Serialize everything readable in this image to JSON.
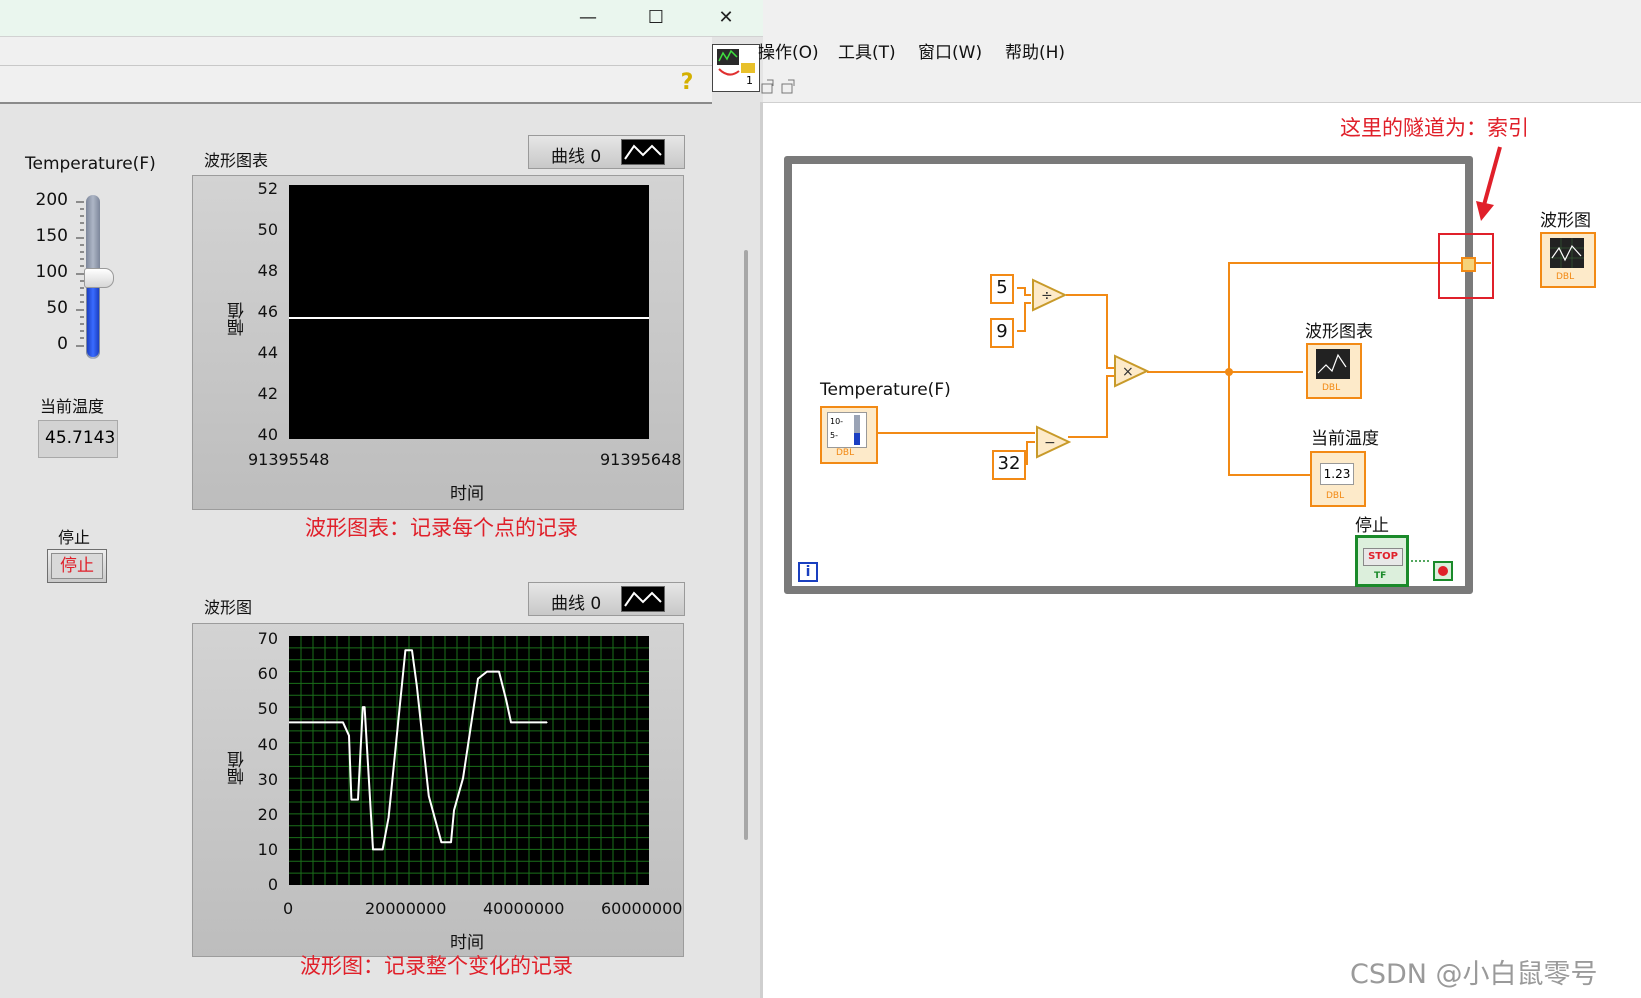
{
  "front_panel": {
    "window_buttons": {
      "minimize": "—",
      "maximize": "☐",
      "close": "✕"
    },
    "help_icon": "?",
    "vi_icon_badge": "1",
    "slider": {
      "label": "Temperature(F)",
      "ticks": [
        "200",
        "150",
        "100",
        "50",
        "0"
      ],
      "value": 100,
      "range": [
        0,
        200
      ]
    },
    "current_temp": {
      "label": "当前温度",
      "value": "45.7143"
    },
    "stop": {
      "label": "停止",
      "button_text": "停止"
    },
    "waveform_chart": {
      "title": "波形图表",
      "legend": "曲线 0",
      "ylabel": "幅值",
      "xlabel": "时间",
      "y_ticks": [
        "52",
        "50",
        "48",
        "46",
        "44",
        "42",
        "40"
      ],
      "x_ticks": [
        "91395548",
        "91395648"
      ],
      "annotation": "波形图表：记录每个点的记录"
    },
    "waveform_graph": {
      "title": "波形图",
      "legend": "曲线 0",
      "ylabel": "幅值",
      "xlabel": "时间",
      "y_ticks": [
        "70",
        "60",
        "50",
        "40",
        "30",
        "20",
        "10",
        "0"
      ],
      "x_ticks": [
        "0",
        "20000000",
        "40000000",
        "60000000"
      ],
      "annotation": "波形图：记录整个变化的记录"
    }
  },
  "chart_data": [
    {
      "type": "line",
      "title": "波形图表",
      "xlabel": "时间",
      "ylabel": "幅值",
      "series": [
        {
          "name": "曲线 0",
          "x": [
            91395548,
            91395648
          ],
          "y": [
            45.7143,
            45.7143
          ]
        }
      ],
      "xlim": [
        91395548,
        91395648
      ],
      "ylim": [
        40,
        52
      ],
      "grid": false
    },
    {
      "type": "line",
      "title": "波形图",
      "xlabel": "时间",
      "ylabel": "幅值",
      "series": [
        {
          "name": "曲线 0",
          "x": [
            0,
            9000000,
            10000000,
            10400000,
            11500000,
            12300000,
            12600000,
            14000000,
            15600000,
            16600000,
            19400000,
            20500000,
            21300000,
            23300000,
            25400000,
            27000000,
            27500000,
            29000000,
            31500000,
            33000000,
            35000000,
            36200000,
            37000000,
            43000000
          ],
          "y": [
            45.7,
            45.7,
            42,
            24,
            24,
            50,
            50,
            10,
            10,
            19,
            66,
            66,
            56,
            25,
            12,
            12,
            21,
            30,
            58,
            60,
            60,
            52,
            45.7,
            45.7
          ]
        }
      ],
      "xlim": [
        0,
        60000000
      ],
      "ylim": [
        0,
        70
      ],
      "grid": true
    }
  ],
  "block_diagram": {
    "menus": [
      "操作(O)",
      "工具(T)",
      "窗口(W)",
      "帮助(H)"
    ],
    "annotation": "这里的隧道为：索引",
    "constants": {
      "c5": "5",
      "c9": "9",
      "c32": "32"
    },
    "ops": {
      "divide": "÷",
      "multiply": "×",
      "subtract": "−"
    },
    "labels": {
      "temperature": "Temperature(F)",
      "waveform_chart": "波形图表",
      "current_temp": "当前温度",
      "waveform_graph": "波形图",
      "stop": "停止"
    },
    "terminal_texts": {
      "numeric": "1.23",
      "stop": "STOP",
      "tf": "TF",
      "dbl": "DBL",
      "loop_index": "i",
      "slider_ticks": "10-\n5-"
    }
  },
  "watermark": "CSDN @小白鼠零号",
  "colors": {
    "accent_red": "#e0202a",
    "wire_orange": "#f28a15",
    "bool_green": "#1a8a2a",
    "loop_border": "#7a7a7a",
    "plot_grid": "#1a6f1a"
  }
}
